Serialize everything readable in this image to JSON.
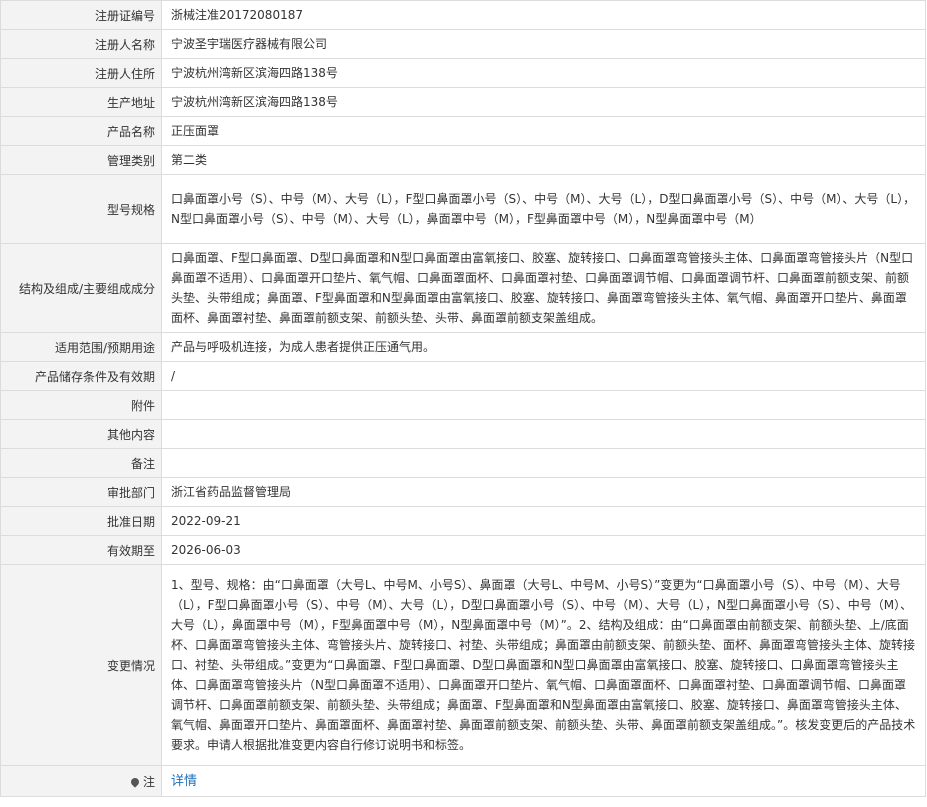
{
  "rows": [
    {
      "label": "注册证编号",
      "value": "浙械注准20172080187"
    },
    {
      "label": "注册人名称",
      "value": "宁波圣宇瑞医疗器械有限公司"
    },
    {
      "label": "注册人住所",
      "value": "宁波杭州湾新区滨海四路138号"
    },
    {
      "label": "生产地址",
      "value": "宁波杭州湾新区滨海四路138号"
    },
    {
      "label": "产品名称",
      "value": "正压面罩"
    },
    {
      "label": "管理类别",
      "value": "第二类"
    },
    {
      "label": "型号规格",
      "value": "口鼻面罩小号（S）、中号（M）、大号（L），F型口鼻面罩小号（S）、中号（M）、大号（L），D型口鼻面罩小号（S）、中号（M）、大号（L），N型口鼻面罩小号（S）、中号（M）、大号（L），鼻面罩中号（M），F型鼻面罩中号（M），N型鼻面罩中号（M）"
    },
    {
      "label": "结构及组成/主要组成成分",
      "value": "口鼻面罩、F型口鼻面罩、D型口鼻面罩和N型口鼻面罩由富氧接口、胶塞、旋转接口、口鼻面罩弯管接头主体、口鼻面罩弯管接头片（N型口鼻面罩不适用）、口鼻面罩开口垫片、氧气帽、口鼻面罩面杯、口鼻面罩衬垫、口鼻面罩调节帽、口鼻面罩调节杆、口鼻面罩前额支架、前额头垫、头带组成；鼻面罩、F型鼻面罩和N型鼻面罩由富氧接口、胶塞、旋转接口、鼻面罩弯管接头主体、氧气帽、鼻面罩开口垫片、鼻面罩面杯、鼻面罩衬垫、鼻面罩前额支架、前额头垫、头带、鼻面罩前额支架盖组成。"
    },
    {
      "label": "适用范围/预期用途",
      "value": "产品与呼吸机连接，为成人患者提供正压通气用。"
    },
    {
      "label": "产品储存条件及有效期",
      "value": "/"
    },
    {
      "label": "附件",
      "value": ""
    },
    {
      "label": "其他内容",
      "value": ""
    },
    {
      "label": "备注",
      "value": ""
    },
    {
      "label": "审批部门",
      "value": "浙江省药品监督管理局"
    },
    {
      "label": "批准日期",
      "value": "2022-09-21"
    },
    {
      "label": "有效期至",
      "value": "2026-06-03"
    },
    {
      "label": "变更情况",
      "value": "1、型号、规格：由“口鼻面罩（大号L、中号M、小号S）、鼻面罩（大号L、中号M、小号S）”变更为“口鼻面罩小号（S）、中号（M）、大号（L），F型口鼻面罩小号（S）、中号（M）、大号（L），D型口鼻面罩小号（S）、中号（M）、大号（L），N型口鼻面罩小号（S）、中号（M）、大号（L），鼻面罩中号（M），F型鼻面罩中号（M），N型鼻面罩中号（M）”。2、结构及组成：由“口鼻面罩由前额支架、前额头垫、上/底面杯、口鼻面罩弯管接头主体、弯管接头片、旋转接口、衬垫、头带组成；鼻面罩由前额支架、前额头垫、面杯、鼻面罩弯管接头主体、旋转接口、衬垫、头带组成。”变更为“口鼻面罩、F型口鼻面罩、D型口鼻面罩和N型口鼻面罩由富氧接口、胶塞、旋转接口、口鼻面罩弯管接头主体、口鼻面罩弯管接头片（N型口鼻面罩不适用）、口鼻面罩开口垫片、氧气帽、口鼻面罩面杯、口鼻面罩衬垫、口鼻面罩调节帽、口鼻面罩调节杆、口鼻面罩前额支架、前额头垫、头带组成；鼻面罩、F型鼻面罩和N型鼻面罩由富氧接口、胶塞、旋转接口、鼻面罩弯管接头主体、氧气帽、鼻面罩开口垫片、鼻面罩面杯、鼻面罩衬垫、鼻面罩前额支架、前额头垫、头带、鼻面罩前额支架盖组成。”。核发变更后的产品技术要求。申请人根据批准变更内容自行修订说明书和标签。"
    }
  ],
  "note": {
    "label": "注",
    "link_text": "详情",
    "icon": "pin-icon"
  }
}
